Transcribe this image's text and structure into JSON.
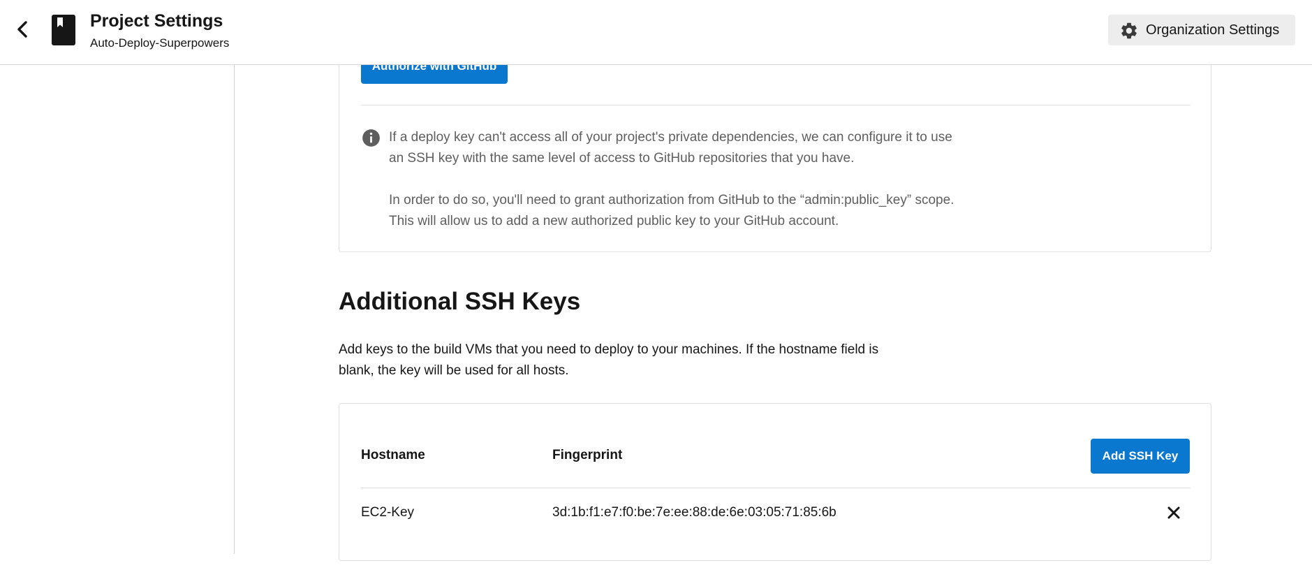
{
  "header": {
    "title": "Project Settings",
    "subtitle": "Auto-Deploy-Superpowers",
    "org_settings_label": "Organization Settings",
    "icons": {
      "back": "chevron-left-icon",
      "project": "bookmark-book-icon",
      "settings": "gear-icon"
    }
  },
  "github_card": {
    "authorize_label": "Authorize with GitHub",
    "info_paragraph_1": "If a deploy key can't access all of your project's private dependencies, we can configure it to use an SSH key with the same level of access to GitHub repositories that you have.",
    "info_paragraph_2": "In order to do so, you'll need to grant authorization from GitHub to the “admin:public_key” scope. This will allow us to add a new authorized public key to your GitHub account.",
    "info_icon": "info-icon"
  },
  "ssh_section": {
    "title": "Additional SSH Keys",
    "description": "Add keys to the build VMs that you need to deploy to your machines. If the hostname field is blank, the key will be used for all hosts.",
    "columns": {
      "hostname": "Hostname",
      "fingerprint": "Fingerprint"
    },
    "add_button_label": "Add SSH Key",
    "rows": [
      {
        "hostname": "EC2-Key",
        "fingerprint": "3d:1b:f1:e7:f0:be:7e:ee:88:de:6e:03:05:71:85:6b",
        "delete_icon": "close-icon"
      }
    ]
  },
  "colors": {
    "primary": "#0b78d0",
    "text": "#161616",
    "muted": "#5e5e5e",
    "border": "#e0e0e0"
  }
}
